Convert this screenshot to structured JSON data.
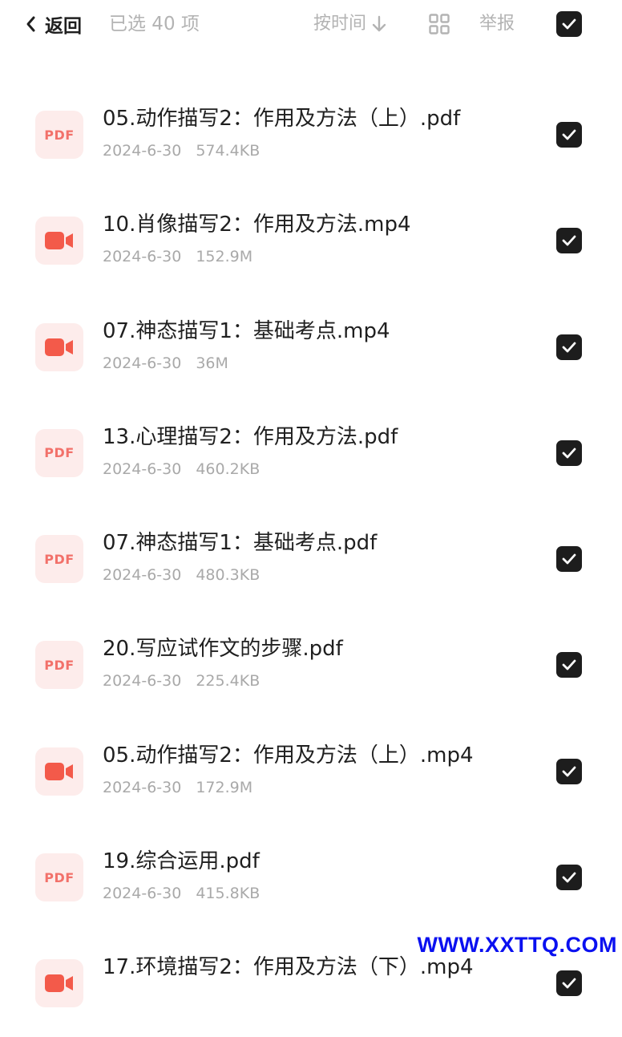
{
  "header": {
    "back_label": "返回",
    "selected_count": "已选 40 项",
    "sort_label": "按时间",
    "report_label": "举报"
  },
  "files": [
    {
      "name": "05.动作描写2：作用及方法（上）.pdf",
      "date": "2024-6-30",
      "size": "574.4KB",
      "type": "pdf",
      "icon": "PDF"
    },
    {
      "name": "10.肖像描写2：作用及方法.mp4",
      "date": "2024-6-30",
      "size": "152.9M",
      "type": "video",
      "icon": "video-icon"
    },
    {
      "name": "07.神态描写1：基础考点.mp4",
      "date": "2024-6-30",
      "size": "36M",
      "type": "video",
      "icon": "video-icon"
    },
    {
      "name": "13.心理描写2：作用及方法.pdf",
      "date": "2024-6-30",
      "size": "460.2KB",
      "type": "pdf",
      "icon": "PDF"
    },
    {
      "name": "07.神态描写1：基础考点.pdf",
      "date": "2024-6-30",
      "size": "480.3KB",
      "type": "pdf",
      "icon": "PDF"
    },
    {
      "name": "20.写应试作文的步骤.pdf",
      "date": "2024-6-30",
      "size": "225.4KB",
      "type": "pdf",
      "icon": "PDF"
    },
    {
      "name": "05.动作描写2：作用及方法（上）.mp4",
      "date": "2024-6-30",
      "size": "172.9M",
      "type": "video",
      "icon": "video-icon"
    },
    {
      "name": "19.综合运用.pdf",
      "date": "2024-6-30",
      "size": "415.8KB",
      "type": "pdf",
      "icon": "PDF"
    },
    {
      "name": "17.环境描写2：作用及方法（下）.mp4",
      "date": "",
      "size": "",
      "type": "video",
      "icon": "video-icon"
    }
  ],
  "watermark": "WWW.XXTTQ.COM",
  "colors": {
    "accent_dark": "#1d1d1d",
    "icon_bg": "#fdeceb",
    "icon_red": "#f2716a",
    "video_red": "#f35a4a",
    "muted_text": "#a9a9a9",
    "watermark": "#0a10f0"
  }
}
